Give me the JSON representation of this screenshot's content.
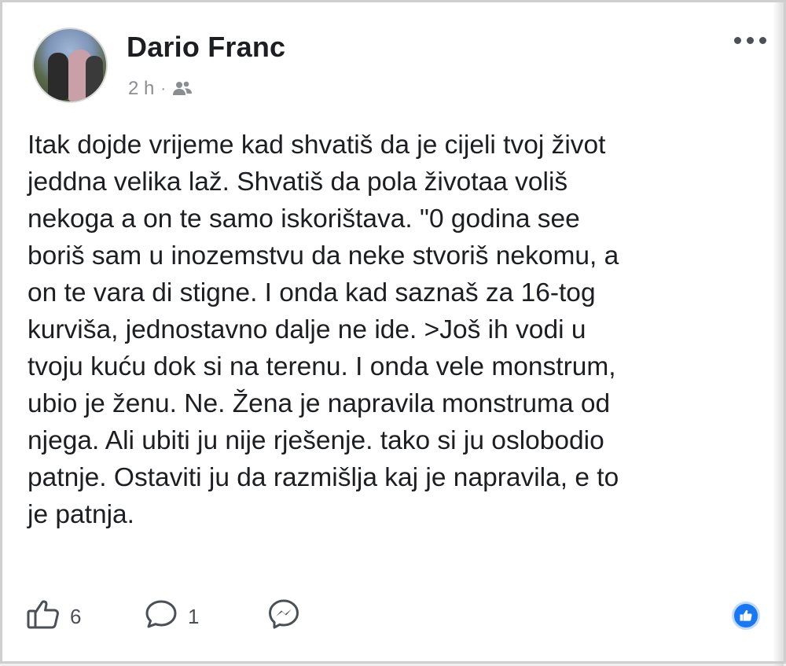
{
  "post": {
    "author": "Dario Franc",
    "time": "2 h",
    "separator": "·",
    "audience_icon": "friends-icon",
    "text": "Itak dojde vrijeme kad shvatiš da je cijeli tvoj život\njeddna velika laž. Shvatiš da pola životaa voliš\nnekoga a on te samo iskorištava. \"0 godina see\nboriš sam u inozemstvu da neke stvoriš nekomu, a\non te vara di stigne. I onda kad saznaš za 16-tog\nkurviša, jednostavno dalje ne ide. >Još  ih vodi u\ntvoju kuću dok si na terenu. I onda vele monstrum,\nubio je ženu. Ne. Žena je napravila monstruma od\nnjega. Ali ubiti ju nije rješenje. tako si ju oslobodio\npatnje. Ostaviti ju da razmišlja kaj je napravila, e to\nje patnja."
  },
  "footer": {
    "like_count": "6",
    "comment_count": "1",
    "like_icon": "thumbs-up-icon",
    "comment_icon": "comment-bubble-icon",
    "share_icon": "messenger-icon",
    "reaction_icon": "like-reaction-icon"
  },
  "colors": {
    "accent": "#1877f2",
    "meta_text": "#8a8d91",
    "body_text": "#1c1e21"
  }
}
